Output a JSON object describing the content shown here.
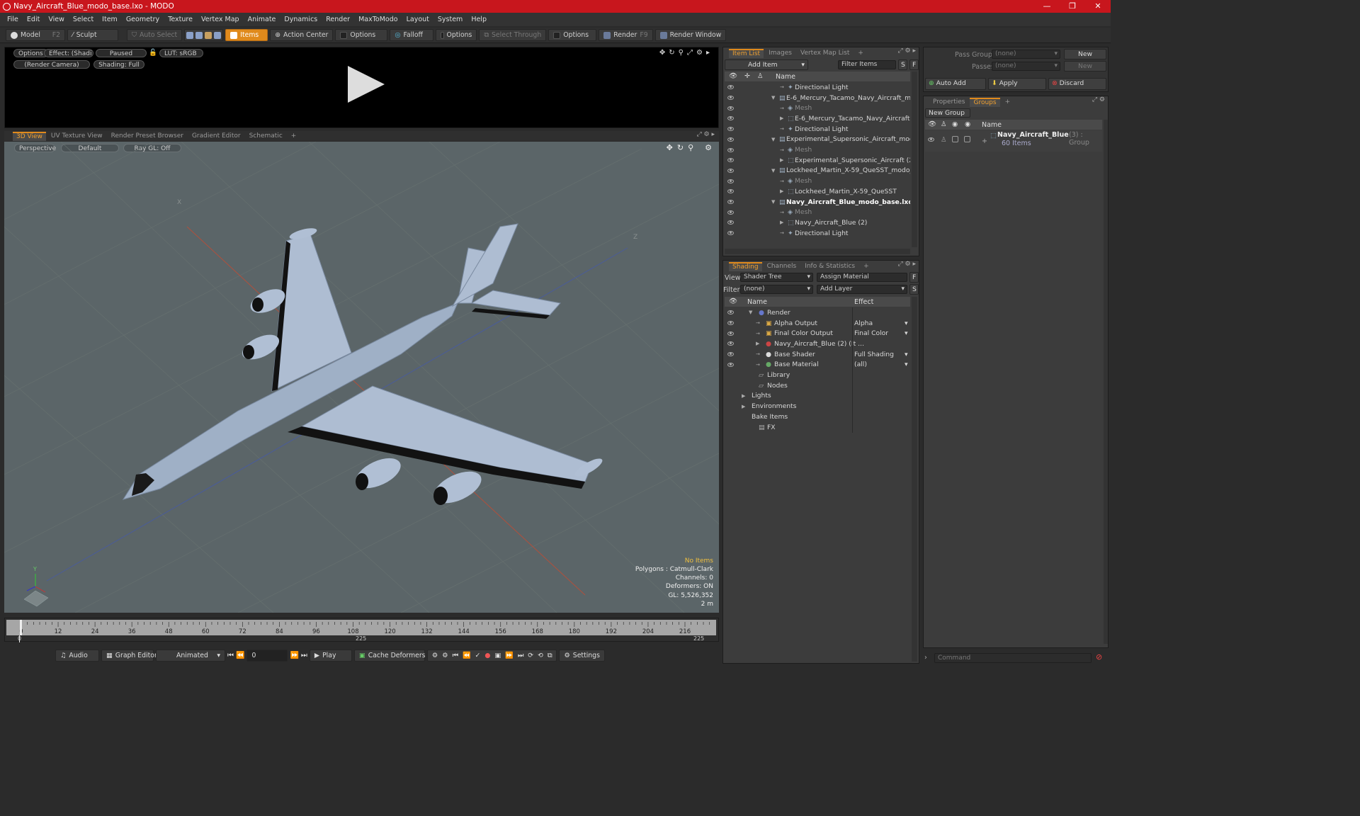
{
  "window": {
    "title": "Navy_Aircraft_Blue_modo_base.lxo - MODO",
    "controls": [
      "—",
      "❐",
      "✕"
    ]
  },
  "menu": [
    "File",
    "Edit",
    "View",
    "Select",
    "Item",
    "Geometry",
    "Texture",
    "Vertex Map",
    "Animate",
    "Dynamics",
    "Render",
    "MaxToModo",
    "Layout",
    "System",
    "Help"
  ],
  "toolbar": {
    "model": "Model",
    "model_key": "F2",
    "sculpt": "Sculpt",
    "auto_select": "Auto Select",
    "items": "Items",
    "action_center": "Action Center",
    "options1": "Options",
    "falloff": "Falloff",
    "options2": "Options",
    "select_through": "Select Through",
    "options3": "Options",
    "render": "Render",
    "render_key": "F9",
    "render_window": "Render Window"
  },
  "render_view": {
    "options": "Options",
    "effect": "Effect: (Shadi...",
    "paused": "Paused",
    "lut": "LUT: sRGB",
    "camera": "(Render Camera)",
    "shading": "Shading: Full"
  },
  "viewport_tabs": [
    "3D View",
    "UV Texture View",
    "Render Preset Browser",
    "Gradient Editor",
    "Schematic",
    "+"
  ],
  "viewport": {
    "perspective": "Perspective",
    "default": "Default",
    "raygl": "Ray GL: Off",
    "axis_x": "X",
    "axis_z": "Z",
    "axis_y": "Y",
    "hud": [
      "No Items",
      "Polygons : Catmull-Clark",
      "Channels: 0",
      "Deformers: ON",
      "GL: 5,526,352",
      "2 m"
    ]
  },
  "timeline": {
    "ticks": [
      "0",
      "12",
      "24",
      "36",
      "48",
      "60",
      "72",
      "84",
      "96",
      "108",
      "120",
      "132",
      "144",
      "156",
      "168",
      "180",
      "192",
      "204",
      "216"
    ],
    "start": "0",
    "mid": "225",
    "end": "225"
  },
  "bottombar": {
    "audio": "Audio",
    "graph_editor": "Graph Editor",
    "animated": "Animated",
    "frame": "0",
    "play": "Play",
    "cache_deformers": "Cache Deformers",
    "settings": "Settings"
  },
  "itemlist": {
    "tabs": [
      "Item List",
      "Images",
      "Vertex Map List",
      "+"
    ],
    "add_item": "Add Item",
    "filter_items": "Filter Items",
    "s": "S",
    "f": "F",
    "col_name": "Name",
    "rows": [
      {
        "label": "Directional Light",
        "indent": 3,
        "type": "light",
        "exp": ""
      },
      {
        "label": "E-6_Mercury_Tacamo_Navy_Aircraft_m ...",
        "indent": 2,
        "type": "scene",
        "exp": "▼"
      },
      {
        "label": "Mesh",
        "indent": 3,
        "type": "mesh",
        "exp": "",
        "dim": true
      },
      {
        "label": "E-6_Mercury_Tacamo_Navy_Aircraft",
        "indent": 3,
        "type": "group",
        "exp": "▶"
      },
      {
        "label": "Directional Light",
        "indent": 3,
        "type": "light",
        "exp": ""
      },
      {
        "label": "Experimental_Supersonic_Aircraft_modo...",
        "indent": 2,
        "type": "scene",
        "exp": "▼"
      },
      {
        "label": "Mesh",
        "indent": 3,
        "type": "mesh",
        "exp": "",
        "dim": true
      },
      {
        "label": "Experimental_Supersonic_Aircraft (2)",
        "indent": 3,
        "type": "group",
        "exp": "▶"
      },
      {
        "label": "Lockheed_Martin_X-59_QueSST_modo_...",
        "indent": 2,
        "type": "scene",
        "exp": "▼"
      },
      {
        "label": "Mesh",
        "indent": 3,
        "type": "mesh",
        "exp": "",
        "dim": true
      },
      {
        "label": "Lockheed_Martin_X-59_QueSST",
        "indent": 3,
        "type": "group",
        "exp": "▶"
      },
      {
        "label": "Navy_Aircraft_Blue_modo_base.lxo",
        "indent": 2,
        "type": "scene",
        "exp": "▼",
        "bold": true
      },
      {
        "label": "Mesh",
        "indent": 3,
        "type": "mesh",
        "exp": "",
        "dim": true
      },
      {
        "label": "Navy_Aircraft_Blue (2)",
        "indent": 3,
        "type": "group",
        "exp": "▶"
      },
      {
        "label": "Directional Light",
        "indent": 3,
        "type": "light",
        "exp": ""
      }
    ]
  },
  "shading": {
    "tabs": [
      "Shading",
      "Channels",
      "Info & Statistics",
      "+"
    ],
    "view_label": "View",
    "view_value": "Shader Tree",
    "assign_material": "Assign Material",
    "f": "F",
    "filter_label": "Filter",
    "filter_value": "(none)",
    "add_layer": "Add Layer",
    "s": "S",
    "col_name": "Name",
    "col_effect": "Effect",
    "rows": [
      {
        "label": "Render",
        "effect": "",
        "indent": 1,
        "exp": "▼",
        "type": "render"
      },
      {
        "label": "Alpha Output",
        "effect": "Alpha",
        "indent": 2,
        "exp": "",
        "type": "output"
      },
      {
        "label": "Final Color Output",
        "effect": "Final Color",
        "indent": 2,
        "exp": "",
        "type": "output"
      },
      {
        "label": "Navy_Aircraft_Blue (2) (It ...",
        "effect": "",
        "indent": 2,
        "exp": "▶",
        "type": "mat"
      },
      {
        "label": "Base Shader",
        "effect": "Full Shading",
        "indent": 2,
        "exp": "",
        "type": "shader"
      },
      {
        "label": "Base Material",
        "effect": "(all)",
        "indent": 2,
        "exp": "",
        "type": "basemat"
      },
      {
        "label": "Library",
        "effect": "",
        "indent": 1,
        "exp": "",
        "type": "folder"
      },
      {
        "label": "Nodes",
        "effect": "",
        "indent": 1,
        "exp": "",
        "type": "folder"
      },
      {
        "label": "Lights",
        "effect": "",
        "indent": 0,
        "exp": "▶",
        "type": "none"
      },
      {
        "label": "Environments",
        "effect": "",
        "indent": 0,
        "exp": "▶",
        "type": "none"
      },
      {
        "label": "Bake Items",
        "effect": "",
        "indent": 0,
        "exp": "",
        "type": "none"
      },
      {
        "label": "FX",
        "effect": "",
        "indent": 1,
        "exp": "",
        "type": "fx"
      }
    ]
  },
  "groups": {
    "pass_groups": "Pass Groups",
    "passes": "Passes",
    "none1": "(none)",
    "none2": "(none)",
    "new1": "New",
    "new2": "New",
    "auto_add": "Auto Add",
    "apply": "Apply",
    "discard": "Discard",
    "tabs": [
      "Properties",
      "Groups",
      "+"
    ],
    "new_group": "New Group",
    "col_name": "Name",
    "item_name": "Navy_Aircraft_Blue",
    "item_meta": "(3) : Group",
    "item_count": "60 Items"
  },
  "command": {
    "placeholder": "Command"
  }
}
